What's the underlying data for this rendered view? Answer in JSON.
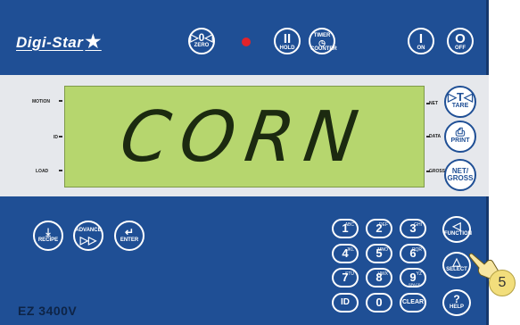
{
  "brand": {
    "logo": "Digi-Star"
  },
  "model": "EZ 3400V",
  "display": {
    "text": "CORN"
  },
  "side_labels": {
    "motion": "MOTION",
    "id": "ID",
    "load": "LOAD",
    "net": "NET",
    "data": "DATA",
    "gross": "GROSS"
  },
  "top_buttons": {
    "zero": {
      "symbol": "▷0◁",
      "label": "ZERO"
    },
    "hold": {
      "symbol": "II",
      "label": "HOLD"
    },
    "timer": {
      "top": "TIMER",
      "label": "COUNTER"
    },
    "on": {
      "symbol": "I",
      "label": "ON"
    },
    "off": {
      "symbol": "O",
      "label": "OFF"
    }
  },
  "right_buttons": {
    "tare": {
      "symbol": "▷T◁",
      "label": "TARE"
    },
    "print": {
      "symbol": "⎙",
      "label": "PRINT"
    },
    "netgross": {
      "line1": "NET/",
      "label": "GROSS"
    }
  },
  "bottom_buttons": {
    "recipe": {
      "symbol": "⤓",
      "label": "RECIPE"
    },
    "advance": {
      "symbol": "▷▷",
      "label": "ADVANCE"
    },
    "enter": {
      "symbol": "↵",
      "label": "ENTER"
    },
    "function": {
      "symbol": "◁",
      "label": "FUNCTION"
    },
    "select": {
      "symbol": "△",
      "label": "SELECT"
    },
    "help": {
      "symbol": "?",
      "label": "HELP"
    }
  },
  "keypad": [
    {
      "key": "1",
      "sub": "ABC"
    },
    {
      "key": "2",
      "sub": "DEF"
    },
    {
      "key": "3",
      "sub": "GHI"
    },
    {
      "key": "4",
      "sub": "JKL"
    },
    {
      "key": "5",
      "sub": "MNO"
    },
    {
      "key": "6",
      "sub": "PQR"
    },
    {
      "key": "7",
      "sub": "STU"
    },
    {
      "key": "8",
      "sub": "VWX"
    },
    {
      "key": "9",
      "sub": "YZ"
    },
    {
      "key": "ID",
      "sub": ""
    },
    {
      "key": "0",
      "sub": ""
    },
    {
      "key": "CLEAR",
      "sub": ""
    }
  ],
  "keypad_space_label": "SPACE",
  "callout": "5",
  "colors": {
    "panel": "#1f4f95",
    "lcd": "#b6d66e",
    "led": "#e2232a",
    "callout": "#f2de7c"
  }
}
